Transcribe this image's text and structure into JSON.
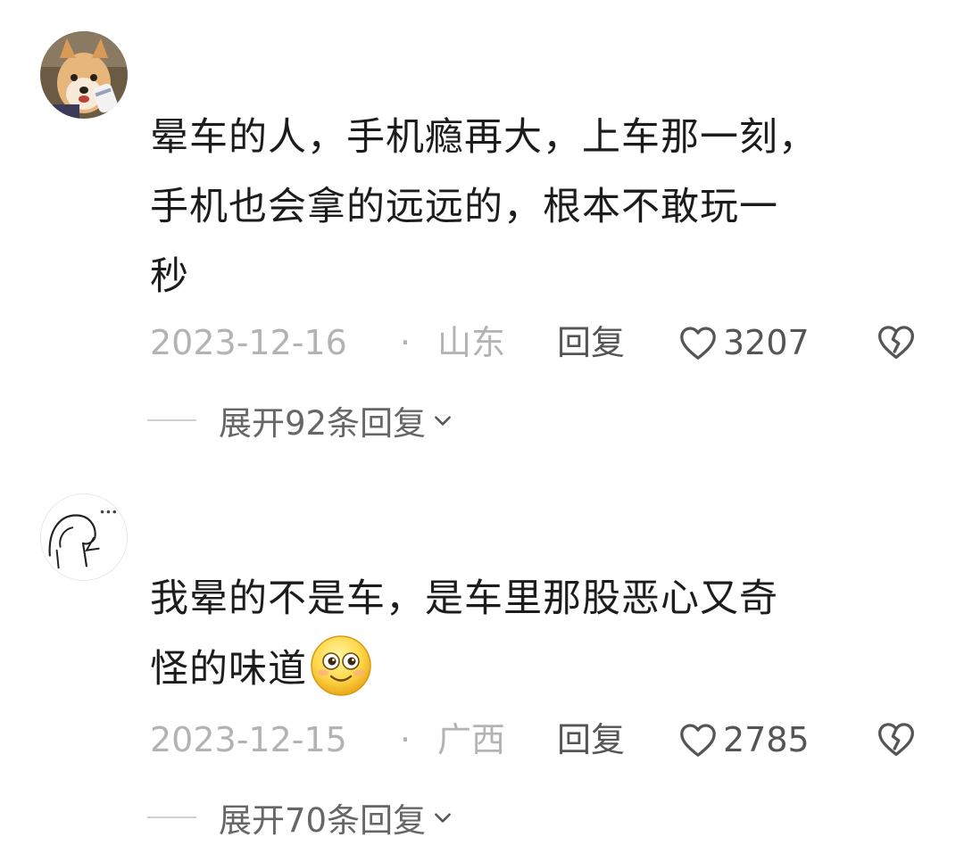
{
  "comments": [
    {
      "avatar": "shiba-dog-avatar",
      "text_lines": [
        "晕车的人，手机瘾再大，上车那一刻，",
        "手机也会拿的远远的，根本不敢玩一",
        "秒"
      ],
      "date": "2023-12-16",
      "separator": "·",
      "location": "山东",
      "reply_label": "回复",
      "likes": "3207",
      "expand_label": "展开92条回复"
    },
    {
      "avatar": "sketch-doodle-avatar",
      "text_lines": [
        "我晕的不是车，是车里那股恶心又奇",
        "怪的味道"
      ],
      "emoji": "smiley-emoji",
      "date": "2023-12-15",
      "separator": "·",
      "location": "广西",
      "reply_label": "回复",
      "likes": "2785",
      "expand_label": "展开70条回复"
    }
  ],
  "icons": {
    "like": "heart-outline-icon",
    "dislike": "broken-heart-icon",
    "expand": "chevron-down-icon"
  },
  "colors": {
    "text": "#1c1c1c",
    "meta": "#b3b3b3",
    "action": "#555555",
    "expand": "#666666"
  }
}
